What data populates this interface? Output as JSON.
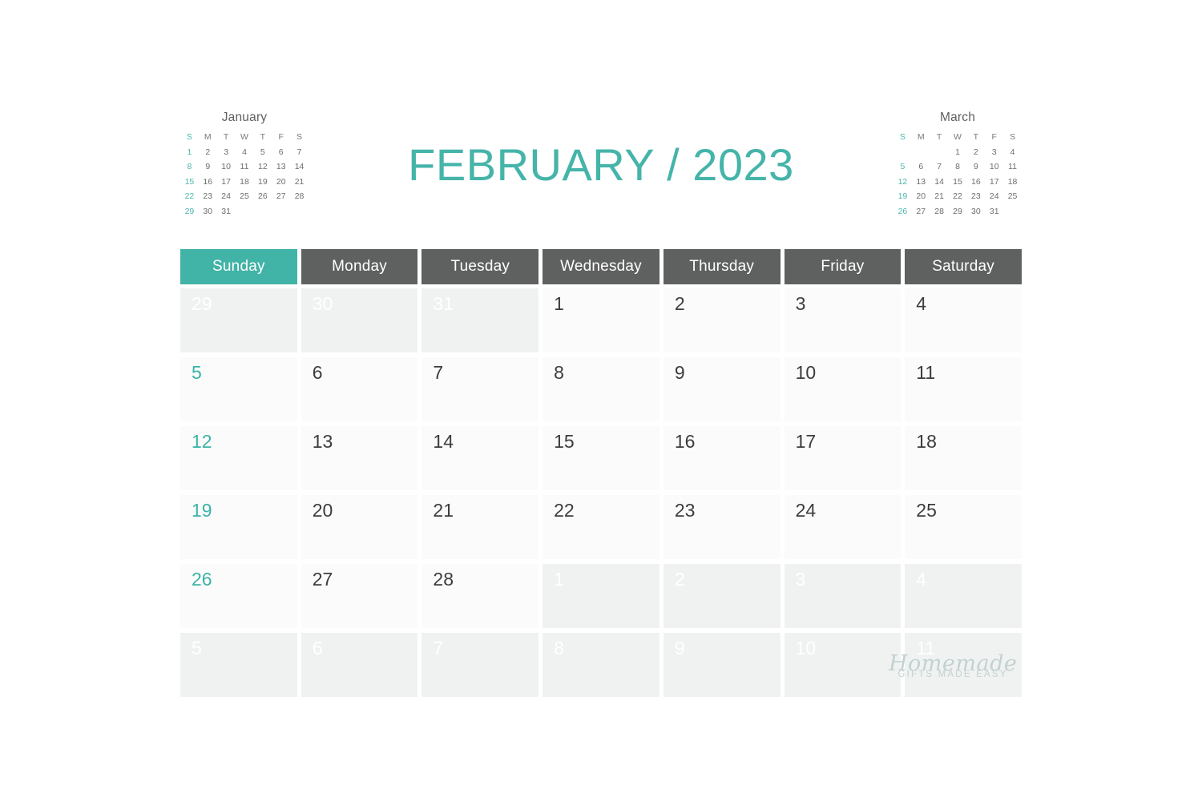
{
  "title": "FEBRUARY / 2023",
  "colors": {
    "accent": "#42b3a7",
    "header_gray": "#5f6160",
    "out_of_month_bg": "#f0f2f2",
    "in_month_bg": "#fafbfa",
    "day_text": "#3c3c3c"
  },
  "mini_calendars": [
    {
      "name": "january",
      "title": "January",
      "dow": [
        "S",
        "M",
        "T",
        "W",
        "T",
        "F",
        "S"
      ],
      "weeks": [
        [
          "1",
          "2",
          "3",
          "4",
          "5",
          "6",
          "7"
        ],
        [
          "8",
          "9",
          "10",
          "11",
          "12",
          "13",
          "14"
        ],
        [
          "15",
          "16",
          "17",
          "18",
          "19",
          "20",
          "21"
        ],
        [
          "22",
          "23",
          "24",
          "25",
          "26",
          "27",
          "28"
        ],
        [
          "29",
          "30",
          "31",
          "",
          "",
          "",
          ""
        ]
      ]
    },
    {
      "name": "march",
      "title": "March",
      "dow": [
        "S",
        "M",
        "T",
        "W",
        "T",
        "F",
        "S"
      ],
      "weeks": [
        [
          "",
          "",
          "",
          "1",
          "2",
          "3",
          "4"
        ],
        [
          "5",
          "6",
          "7",
          "8",
          "9",
          "10",
          "11"
        ],
        [
          "12",
          "13",
          "14",
          "15",
          "16",
          "17",
          "18"
        ],
        [
          "19",
          "20",
          "21",
          "22",
          "23",
          "24",
          "25"
        ],
        [
          "26",
          "27",
          "28",
          "29",
          "30",
          "31",
          ""
        ]
      ]
    }
  ],
  "day_headers": [
    "Sunday",
    "Monday",
    "Tuesday",
    "Wednesday",
    "Thursday",
    "Friday",
    "Saturday"
  ],
  "weeks": [
    [
      {
        "n": "29",
        "out": true
      },
      {
        "n": "30",
        "out": true
      },
      {
        "n": "31",
        "out": true
      },
      {
        "n": "1",
        "out": false
      },
      {
        "n": "2",
        "out": false
      },
      {
        "n": "3",
        "out": false
      },
      {
        "n": "4",
        "out": false
      }
    ],
    [
      {
        "n": "5",
        "out": false
      },
      {
        "n": "6",
        "out": false
      },
      {
        "n": "7",
        "out": false
      },
      {
        "n": "8",
        "out": false
      },
      {
        "n": "9",
        "out": false
      },
      {
        "n": "10",
        "out": false
      },
      {
        "n": "11",
        "out": false
      }
    ],
    [
      {
        "n": "12",
        "out": false
      },
      {
        "n": "13",
        "out": false
      },
      {
        "n": "14",
        "out": false
      },
      {
        "n": "15",
        "out": false
      },
      {
        "n": "16",
        "out": false
      },
      {
        "n": "17",
        "out": false
      },
      {
        "n": "18",
        "out": false
      }
    ],
    [
      {
        "n": "19",
        "out": false
      },
      {
        "n": "20",
        "out": false
      },
      {
        "n": "21",
        "out": false
      },
      {
        "n": "22",
        "out": false
      },
      {
        "n": "23",
        "out": false
      },
      {
        "n": "24",
        "out": false
      },
      {
        "n": "25",
        "out": false
      }
    ],
    [
      {
        "n": "26",
        "out": false
      },
      {
        "n": "27",
        "out": false
      },
      {
        "n": "28",
        "out": false
      },
      {
        "n": "1",
        "out": true
      },
      {
        "n": "2",
        "out": true
      },
      {
        "n": "3",
        "out": true
      },
      {
        "n": "4",
        "out": true
      }
    ],
    [
      {
        "n": "5",
        "out": true
      },
      {
        "n": "6",
        "out": true
      },
      {
        "n": "7",
        "out": true
      },
      {
        "n": "8",
        "out": true
      },
      {
        "n": "9",
        "out": true
      },
      {
        "n": "10",
        "out": true
      },
      {
        "n": "11",
        "out": true
      }
    ]
  ],
  "watermark": {
    "script": "Homemade",
    "sub": "GIFTS MADE EASY"
  }
}
